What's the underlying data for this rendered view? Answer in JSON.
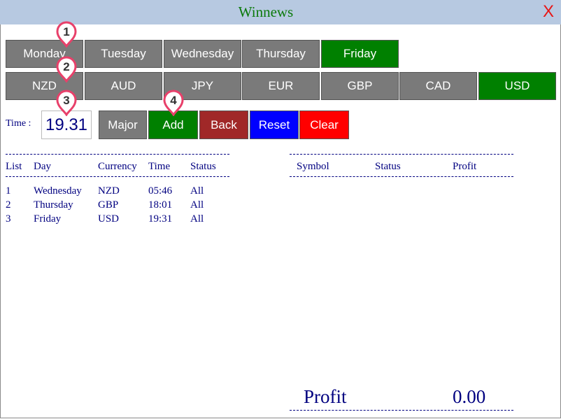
{
  "window": {
    "title": "Winnews",
    "close_label": "X"
  },
  "days": [
    "Monday",
    "Tuesday",
    "Wednesday",
    "Thursday",
    "Friday"
  ],
  "currencies": [
    "NZD",
    "AUD",
    "JPY",
    "EUR",
    "GBP",
    "CAD",
    "USD"
  ],
  "time": {
    "label": "Time :",
    "value": "19.31"
  },
  "actions": {
    "major": "Major",
    "add": "Add",
    "back": "Back",
    "reset": "Reset",
    "clear": "Clear"
  },
  "list_table": {
    "headers": [
      "List",
      "Day",
      "Currency",
      "Time",
      "Status"
    ],
    "rows": [
      [
        "1",
        "Wednesday",
        "NZD",
        "05:46",
        "All"
      ],
      [
        "2",
        "Thursday",
        "GBP",
        "18:01",
        "All"
      ],
      [
        "3",
        "Friday",
        "USD",
        "19:31",
        "All"
      ]
    ]
  },
  "profit_table": {
    "headers": [
      "Symbol",
      "Status",
      "Profit"
    ]
  },
  "total": {
    "label": "Profit",
    "value": "0.00"
  },
  "markers": [
    "1",
    "2",
    "3",
    "4"
  ],
  "colors": {
    "selected": "#008000",
    "unselected": "#7a7a7a",
    "title_bar": "#b7c9e1",
    "text": "#000080"
  }
}
